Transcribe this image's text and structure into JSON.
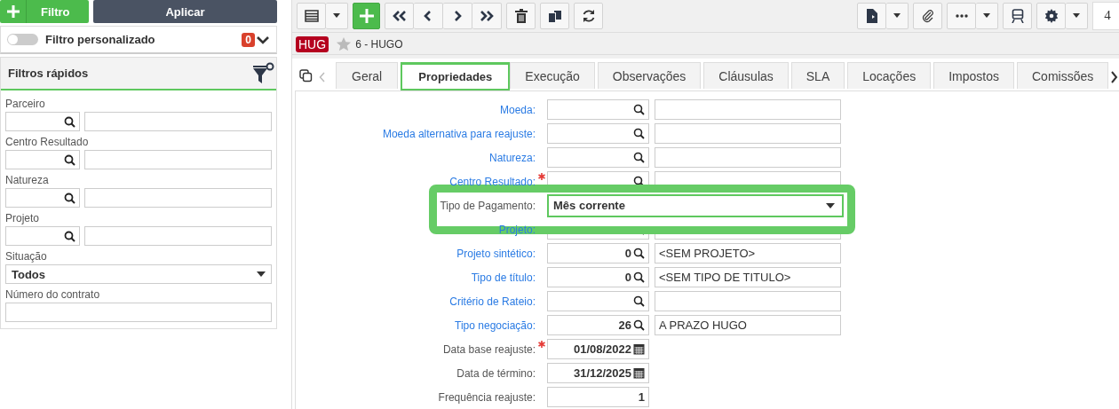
{
  "filter_panel": {
    "add_button": "Filtro",
    "apply_button": "Aplicar",
    "custom_filter": {
      "label": "Filtro personalizado",
      "on": false,
      "count": "0"
    },
    "quick_filters": {
      "title": "Filtros rápidos",
      "fields": [
        {
          "label": "Parceiro",
          "kind": "lookup"
        },
        {
          "label": "Centro Resultado",
          "kind": "lookup"
        },
        {
          "label": "Natureza",
          "kind": "lookup"
        },
        {
          "label": "Projeto",
          "kind": "lookup"
        },
        {
          "label": "Situação",
          "kind": "select",
          "value": "Todos"
        },
        {
          "label": "Número do contrato",
          "kind": "text"
        }
      ]
    }
  },
  "toolbar": {
    "page_field": "4"
  },
  "record": {
    "badge": "HUG",
    "favorite": false,
    "title": "6 - HUGO"
  },
  "tabs": [
    {
      "label": "Geral",
      "selected": false
    },
    {
      "label": "Propriedades",
      "selected": true
    },
    {
      "label": "Execução",
      "selected": false
    },
    {
      "label": "Observações",
      "selected": false
    },
    {
      "label": "Cláusulas",
      "selected": false
    },
    {
      "label": "SLA",
      "selected": false
    },
    {
      "label": "Locações",
      "selected": false
    },
    {
      "label": "Impostos",
      "selected": false
    },
    {
      "label": "Comissões",
      "selected": false
    }
  ],
  "form": [
    {
      "label": "Moeda:",
      "link": true,
      "required": false,
      "kind": "lookup",
      "highlighted": false
    },
    {
      "label": "Moeda alternativa para reajuste:",
      "link": true,
      "required": false,
      "kind": "lookup",
      "highlighted": false
    },
    {
      "label": "Natureza:",
      "link": true,
      "required": false,
      "kind": "lookup",
      "highlighted": false
    },
    {
      "label": "Centro Resultado:",
      "link": true,
      "required": true,
      "kind": "lookup",
      "highlighted": false
    },
    {
      "label": "Tipo de Pagamento:",
      "link": false,
      "required": false,
      "kind": "select",
      "value": "Mês corrente",
      "highlighted": true
    },
    {
      "label": "Projeto:",
      "link": true,
      "required": false,
      "kind": "lookup",
      "highlighted": false
    },
    {
      "label": "Projeto sintético:",
      "link": true,
      "required": false,
      "kind": "lookup",
      "code": "0",
      "description": "<SEM PROJETO>",
      "highlighted": false
    },
    {
      "label": "Tipo de título:",
      "link": true,
      "required": false,
      "kind": "lookup",
      "code": "0",
      "description": "<SEM TIPO DE TITULO>",
      "highlighted": false
    },
    {
      "label": "Critério de Rateio:",
      "link": true,
      "required": false,
      "kind": "lookup",
      "highlighted": false
    },
    {
      "label": "Tipo negociação:",
      "link": true,
      "required": false,
      "kind": "lookup",
      "code": "26",
      "description": "A PRAZO HUGO",
      "highlighted": false
    },
    {
      "label": "Data base reajuste:",
      "link": false,
      "required": true,
      "kind": "date",
      "value": "01/08/2022",
      "highlighted": false
    },
    {
      "label": "Data de término:",
      "link": false,
      "required": false,
      "kind": "date",
      "value": "31/12/2025",
      "highlighted": false
    },
    {
      "label": "Frequência reajuste:",
      "link": false,
      "required": false,
      "kind": "number",
      "value": "1",
      "highlighted": false
    }
  ]
}
